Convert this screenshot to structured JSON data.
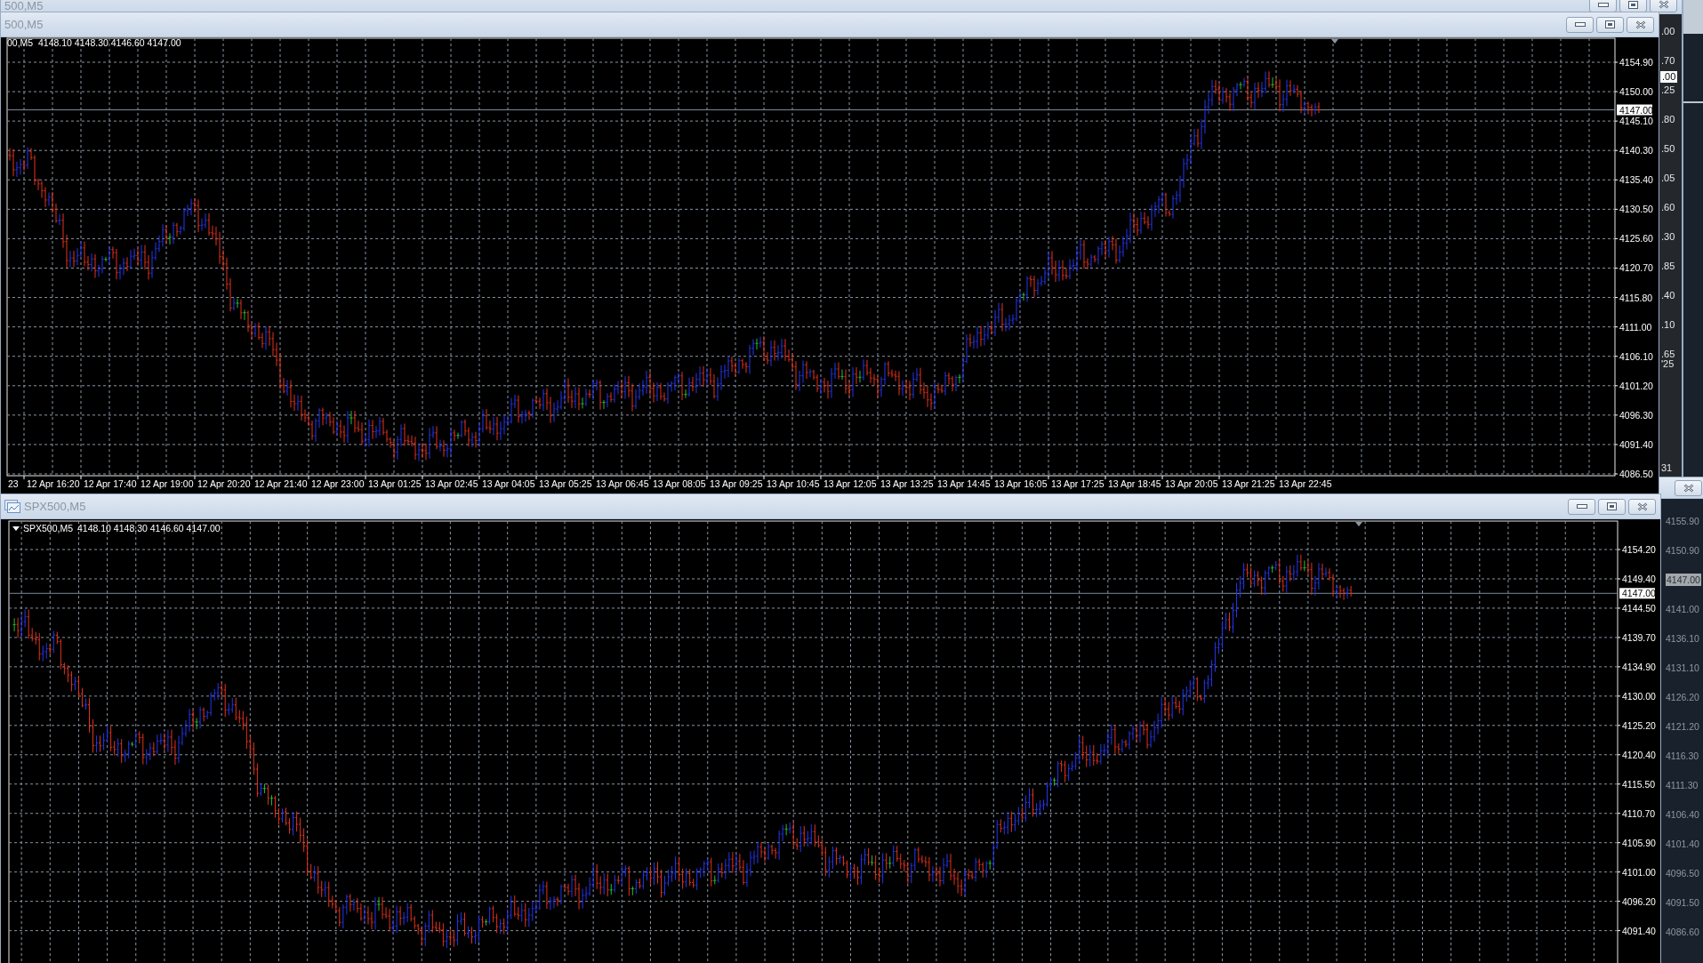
{
  "background_window": {
    "title": "500,M5",
    "axis_labels": [
      ".00",
      ".70",
      ".25",
      ".80",
      ".50",
      ".05",
      ".60",
      ".30",
      ".85",
      ".40",
      ".10",
      ".65"
    ],
    "price_label": ".00",
    "partial_labels": [
      "'25",
      "31"
    ]
  },
  "side_window": {
    "axis_labels": [
      {
        "kind": "price",
        "text": "4155.90"
      },
      {
        "kind": "price",
        "text": "4150.90"
      },
      {
        "kind": "current",
        "text": "4147.00"
      },
      {
        "kind": "price",
        "text": "4141.00"
      },
      {
        "kind": "price",
        "text": "4136.10"
      },
      {
        "kind": "price",
        "text": "4131.10"
      },
      {
        "kind": "price",
        "text": "4126.20"
      },
      {
        "kind": "price",
        "text": "4121.20"
      },
      {
        "kind": "price",
        "text": "4116.30"
      },
      {
        "kind": "price",
        "text": "4111.30"
      },
      {
        "kind": "price",
        "text": "4106.40"
      },
      {
        "kind": "price",
        "text": "4101.40"
      },
      {
        "kind": "price",
        "text": "4096.50"
      },
      {
        "kind": "price",
        "text": "4091.50"
      },
      {
        "kind": "price",
        "text": "4086.60"
      }
    ]
  },
  "chart_windows": [
    {
      "title": "500,M5",
      "header": {
        "symbol": "00,M5",
        "ohlc": "4148.10 4148.30 4146.60 4147.00"
      },
      "price_label": "4147.00",
      "price_axis": [
        "4154.90",
        "4150.00",
        "4145.10",
        "4140.30",
        "4135.40",
        "4130.50",
        "4125.60",
        "4120.70",
        "4115.80",
        "4111.00",
        "4106.10",
        "4101.20",
        "4096.30",
        "4091.40",
        "4086.50"
      ],
      "time_axis": [
        "23",
        "12 Apr 16:20",
        "12 Apr 17:40",
        "12 Apr 19:00",
        "12 Apr 20:20",
        "12 Apr 21:40",
        "12 Apr 23:00",
        "13 Apr 01:25",
        "13 Apr 02:45",
        "13 Apr 04:05",
        "13 Apr 05:25",
        "13 Apr 06:45",
        "13 Apr 08:05",
        "13 Apr 09:25",
        "13 Apr 10:45",
        "13 Apr 12:05",
        "13 Apr 13:25",
        "13 Apr 14:45",
        "13 Apr 16:05",
        "13 Apr 17:25",
        "13 Apr 18:45",
        "13 Apr 20:05",
        "13 Apr 21:25",
        "13 Apr 22:45"
      ]
    },
    {
      "title": "SPX500,M5",
      "header": {
        "symbol": "SPX500,M5",
        "ohlc": "4148.10 4148.30 4146.60 4147.00"
      },
      "price_label": "4147.00",
      "price_axis": [
        "4154.20",
        "4149.40",
        "4144.50",
        "4139.70",
        "4134.90",
        "4130.00",
        "4125.20",
        "4120.40",
        "4115.50",
        "4110.70",
        "4105.90",
        "4101.00",
        "4096.20",
        "4091.40"
      ]
    }
  ]
}
